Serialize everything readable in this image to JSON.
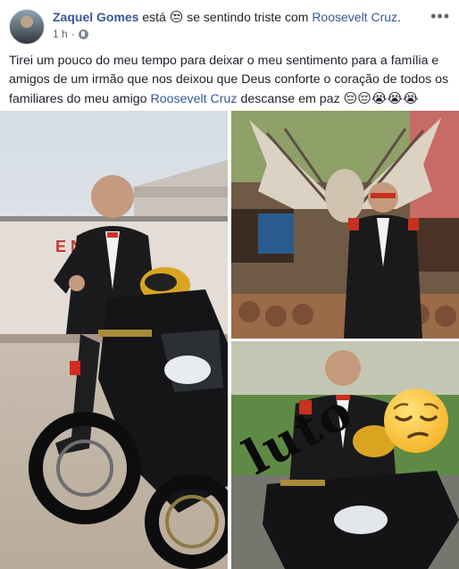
{
  "post": {
    "author": "Zaquel Gomes",
    "feeling_prefix": "está",
    "feeling_emoji": "😒",
    "feeling_text": "se sentindo triste com",
    "tagged": "Roosevelt Cruz",
    "tagged_suffix": ".",
    "time": "1 h",
    "time_separator": "·",
    "text_part1": "Tirei um pouco do meu tempo para deixar o meu sentimento para a família e amigos de um irmão que nos deixou que Deus conforte o coração de todos os familiares do meu amigo",
    "text_mention": "Roosevelt Cruz",
    "text_part2": "descanse em paz",
    "text_emojis": "😔😔😭😭😭",
    "more_label": "•••"
  },
  "photos": {
    "photo3_overlay_text": "luto",
    "photo1_sign_text": "E          NTO"
  },
  "colors": {
    "link": "#385898",
    "text": "#1d2129",
    "meta": "#616770"
  }
}
